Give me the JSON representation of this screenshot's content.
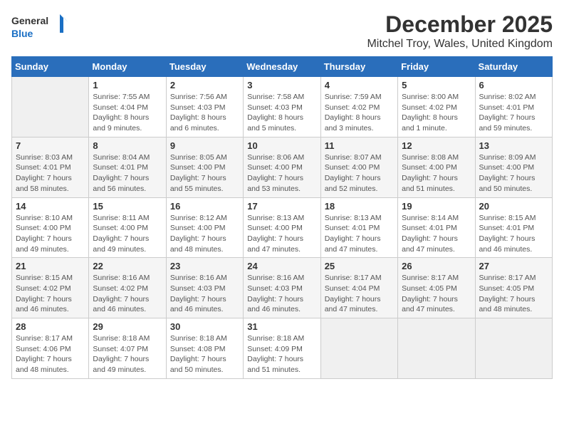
{
  "header": {
    "logo_line1": "General",
    "logo_line2": "Blue",
    "title": "December 2025",
    "subtitle": "Mitchel Troy, Wales, United Kingdom"
  },
  "days_of_week": [
    "Sunday",
    "Monday",
    "Tuesday",
    "Wednesday",
    "Thursday",
    "Friday",
    "Saturday"
  ],
  "weeks": [
    [
      {
        "date": "",
        "info": ""
      },
      {
        "date": "1",
        "info": "Sunrise: 7:55 AM\nSunset: 4:04 PM\nDaylight: 8 hours\nand 9 minutes."
      },
      {
        "date": "2",
        "info": "Sunrise: 7:56 AM\nSunset: 4:03 PM\nDaylight: 8 hours\nand 6 minutes."
      },
      {
        "date": "3",
        "info": "Sunrise: 7:58 AM\nSunset: 4:03 PM\nDaylight: 8 hours\nand 5 minutes."
      },
      {
        "date": "4",
        "info": "Sunrise: 7:59 AM\nSunset: 4:02 PM\nDaylight: 8 hours\nand 3 minutes."
      },
      {
        "date": "5",
        "info": "Sunrise: 8:00 AM\nSunset: 4:02 PM\nDaylight: 8 hours\nand 1 minute."
      },
      {
        "date": "6",
        "info": "Sunrise: 8:02 AM\nSunset: 4:01 PM\nDaylight: 7 hours\nand 59 minutes."
      }
    ],
    [
      {
        "date": "7",
        "info": "Sunrise: 8:03 AM\nSunset: 4:01 PM\nDaylight: 7 hours\nand 58 minutes."
      },
      {
        "date": "8",
        "info": "Sunrise: 8:04 AM\nSunset: 4:01 PM\nDaylight: 7 hours\nand 56 minutes."
      },
      {
        "date": "9",
        "info": "Sunrise: 8:05 AM\nSunset: 4:00 PM\nDaylight: 7 hours\nand 55 minutes."
      },
      {
        "date": "10",
        "info": "Sunrise: 8:06 AM\nSunset: 4:00 PM\nDaylight: 7 hours\nand 53 minutes."
      },
      {
        "date": "11",
        "info": "Sunrise: 8:07 AM\nSunset: 4:00 PM\nDaylight: 7 hours\nand 52 minutes."
      },
      {
        "date": "12",
        "info": "Sunrise: 8:08 AM\nSunset: 4:00 PM\nDaylight: 7 hours\nand 51 minutes."
      },
      {
        "date": "13",
        "info": "Sunrise: 8:09 AM\nSunset: 4:00 PM\nDaylight: 7 hours\nand 50 minutes."
      }
    ],
    [
      {
        "date": "14",
        "info": "Sunrise: 8:10 AM\nSunset: 4:00 PM\nDaylight: 7 hours\nand 49 minutes."
      },
      {
        "date": "15",
        "info": "Sunrise: 8:11 AM\nSunset: 4:00 PM\nDaylight: 7 hours\nand 49 minutes."
      },
      {
        "date": "16",
        "info": "Sunrise: 8:12 AM\nSunset: 4:00 PM\nDaylight: 7 hours\nand 48 minutes."
      },
      {
        "date": "17",
        "info": "Sunrise: 8:13 AM\nSunset: 4:00 PM\nDaylight: 7 hours\nand 47 minutes."
      },
      {
        "date": "18",
        "info": "Sunrise: 8:13 AM\nSunset: 4:01 PM\nDaylight: 7 hours\nand 47 minutes."
      },
      {
        "date": "19",
        "info": "Sunrise: 8:14 AM\nSunset: 4:01 PM\nDaylight: 7 hours\nand 47 minutes."
      },
      {
        "date": "20",
        "info": "Sunrise: 8:15 AM\nSunset: 4:01 PM\nDaylight: 7 hours\nand 46 minutes."
      }
    ],
    [
      {
        "date": "21",
        "info": "Sunrise: 8:15 AM\nSunset: 4:02 PM\nDaylight: 7 hours\nand 46 minutes."
      },
      {
        "date": "22",
        "info": "Sunrise: 8:16 AM\nSunset: 4:02 PM\nDaylight: 7 hours\nand 46 minutes."
      },
      {
        "date": "23",
        "info": "Sunrise: 8:16 AM\nSunset: 4:03 PM\nDaylight: 7 hours\nand 46 minutes."
      },
      {
        "date": "24",
        "info": "Sunrise: 8:16 AM\nSunset: 4:03 PM\nDaylight: 7 hours\nand 46 minutes."
      },
      {
        "date": "25",
        "info": "Sunrise: 8:17 AM\nSunset: 4:04 PM\nDaylight: 7 hours\nand 47 minutes."
      },
      {
        "date": "26",
        "info": "Sunrise: 8:17 AM\nSunset: 4:05 PM\nDaylight: 7 hours\nand 47 minutes."
      },
      {
        "date": "27",
        "info": "Sunrise: 8:17 AM\nSunset: 4:05 PM\nDaylight: 7 hours\nand 48 minutes."
      }
    ],
    [
      {
        "date": "28",
        "info": "Sunrise: 8:17 AM\nSunset: 4:06 PM\nDaylight: 7 hours\nand 48 minutes."
      },
      {
        "date": "29",
        "info": "Sunrise: 8:18 AM\nSunset: 4:07 PM\nDaylight: 7 hours\nand 49 minutes."
      },
      {
        "date": "30",
        "info": "Sunrise: 8:18 AM\nSunset: 4:08 PM\nDaylight: 7 hours\nand 50 minutes."
      },
      {
        "date": "31",
        "info": "Sunrise: 8:18 AM\nSunset: 4:09 PM\nDaylight: 7 hours\nand 51 minutes."
      },
      {
        "date": "",
        "info": ""
      },
      {
        "date": "",
        "info": ""
      },
      {
        "date": "",
        "info": ""
      }
    ]
  ]
}
